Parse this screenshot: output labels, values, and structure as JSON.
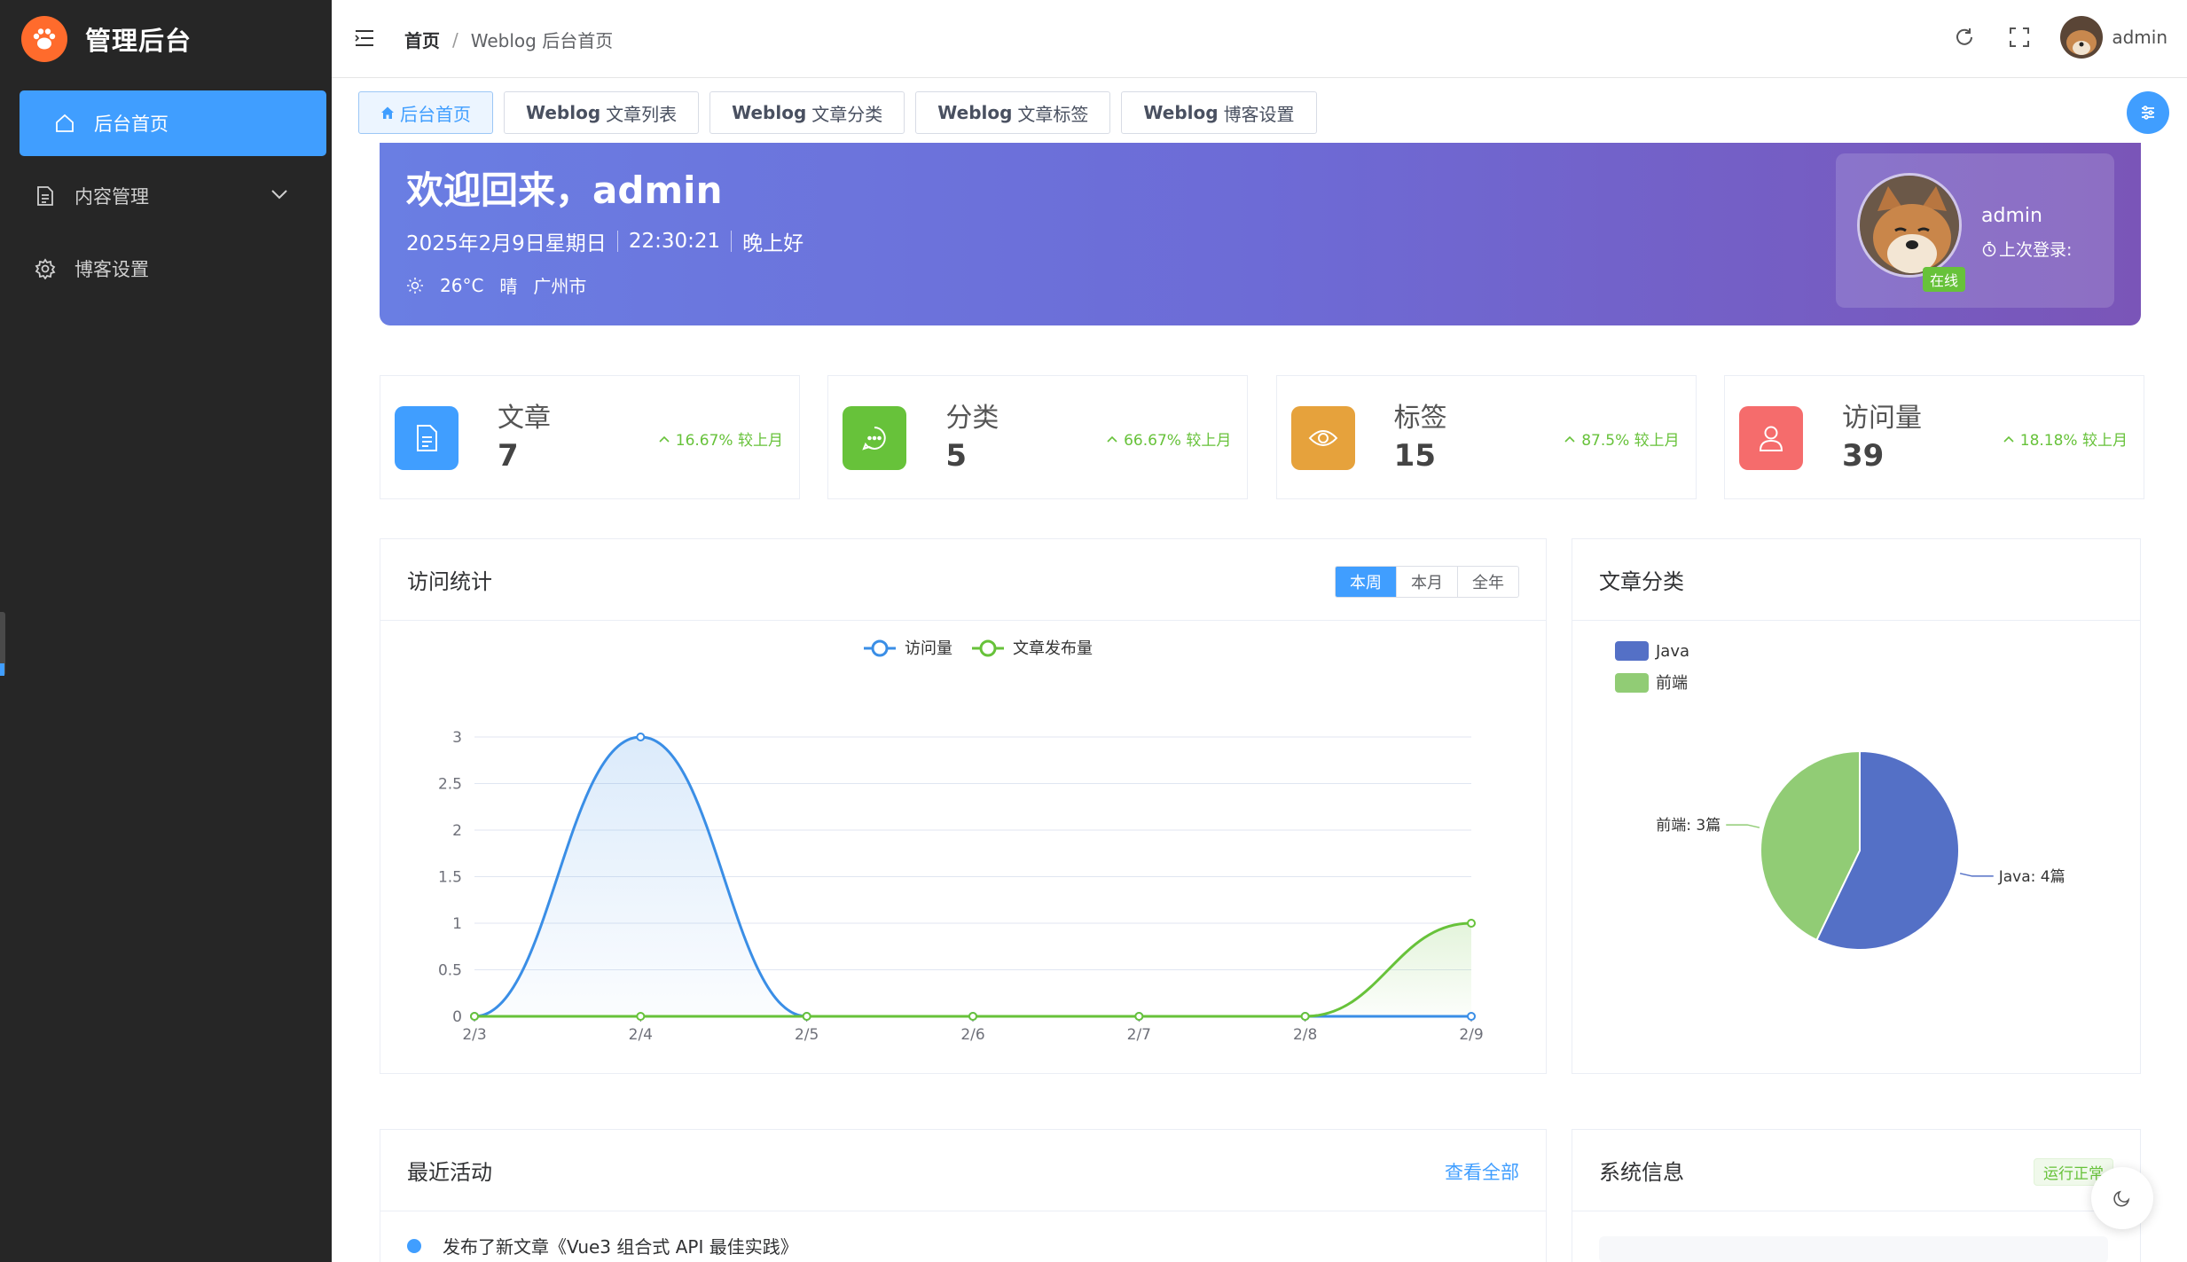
{
  "brand": {
    "title": "管理后台",
    "logo_icon": "paw-icon",
    "logo_color": "#ff6b2c"
  },
  "sidebar": {
    "items": [
      {
        "label": "后台首页",
        "icon": "home-icon",
        "active": true
      },
      {
        "label": "内容管理",
        "icon": "document-icon",
        "expandable": true
      },
      {
        "label": "博客设置",
        "icon": "gear-icon"
      }
    ]
  },
  "header": {
    "breadcrumb": {
      "home": "首页",
      "separator": "/",
      "current": "Weblog 后台首页"
    },
    "user": "admin",
    "icons": [
      "refresh-icon",
      "fullscreen-icon"
    ]
  },
  "tabs": [
    {
      "bold": "",
      "label": "后台首页",
      "active": true
    },
    {
      "bold": "Weblog",
      "label": "文章列表"
    },
    {
      "bold": "Weblog",
      "label": "文章分类"
    },
    {
      "bold": "Weblog",
      "label": "文章标签"
    },
    {
      "bold": "Weblog",
      "label": "博客设置"
    }
  ],
  "welcome": {
    "title": "欢迎回来，admin",
    "date": "2025年2月9日星期日",
    "time": "22:30:21",
    "greeting": "晚上好",
    "temperature": "26°C",
    "weather": "晴",
    "city": "广州市",
    "card": {
      "name": "admin",
      "last_login_label": "上次登录:",
      "status": "在线"
    }
  },
  "stats": [
    {
      "label": "文章",
      "value": "7",
      "trend": "16.67% 较上月",
      "color": "#409eff",
      "icon": "document-icon"
    },
    {
      "label": "分类",
      "value": "5",
      "trend": "66.67% 较上月",
      "color": "#67c23a",
      "icon": "chat-icon"
    },
    {
      "label": "标签",
      "value": "15",
      "trend": "87.5% 较上月",
      "color": "#e6a23c",
      "icon": "eye-icon"
    },
    {
      "label": "访问量",
      "value": "39",
      "trend": "18.18% 较上月",
      "color": "#f56c6c",
      "icon": "user-icon"
    }
  ],
  "visits": {
    "title": "访问统计",
    "ranges": [
      "本周",
      "本月",
      "全年"
    ],
    "active_range": "本周"
  },
  "categories_panel": {
    "title": "文章分类"
  },
  "activity_panel": {
    "title": "最近活动",
    "view_all": "查看全部",
    "first_item": "发布了新文章《Vue3 组合式 API 最佳实践》"
  },
  "system_panel": {
    "title": "系统信息",
    "status": "运行正常"
  },
  "chart_data": [
    {
      "type": "line",
      "x": [
        "2/3",
        "2/4",
        "2/5",
        "2/6",
        "2/7",
        "2/8",
        "2/9"
      ],
      "series": [
        {
          "name": "访问量",
          "values": [
            0,
            3,
            0,
            0,
            0,
            0,
            0
          ],
          "color": "#3a8ee6"
        },
        {
          "name": "文章发布量",
          "values": [
            0,
            0,
            0,
            0,
            0,
            0,
            1
          ],
          "color": "#67c23a"
        }
      ],
      "y_ticks": [
        "0",
        "0.5",
        "1",
        "1.5",
        "2",
        "2.5",
        "3"
      ],
      "ylim": [
        0,
        3
      ],
      "legend": "top-center",
      "grid": true
    },
    {
      "type": "pie",
      "series": [
        {
          "name": "Java",
          "value": 4,
          "label": "Java: 4篇",
          "color": "#5470c6"
        },
        {
          "name": "前端",
          "value": 3,
          "label": "前端: 3篇",
          "color": "#91cc75"
        }
      ],
      "legend": "top-left"
    }
  ]
}
